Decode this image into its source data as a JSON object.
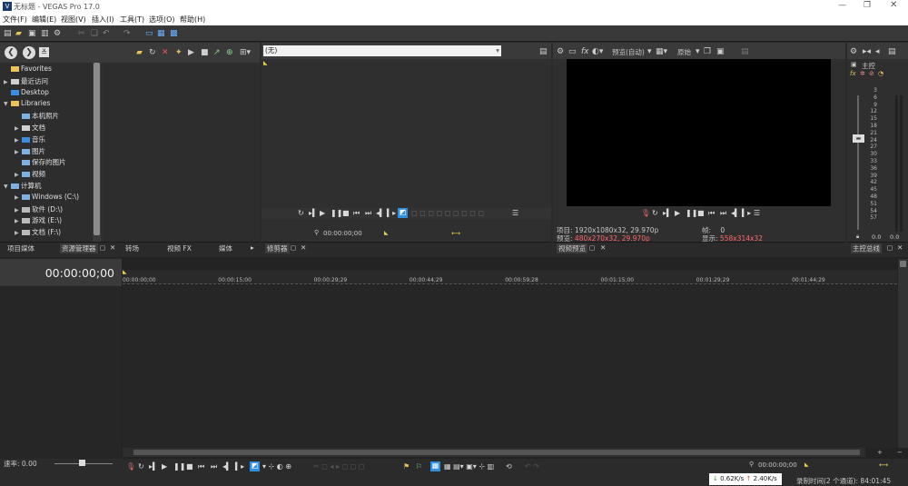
{
  "window": {
    "title": "无标题 - VEGAS Pro 17.0",
    "app_icon": "vegas-icon"
  },
  "menu": [
    "文件(F)",
    "编辑(E)",
    "视图(V)",
    "插入(I)",
    "工具(T)",
    "选项(O)",
    "帮助(H)"
  ],
  "explorer": {
    "items": [
      {
        "label": "Favorites",
        "indent": 0,
        "arrow": "",
        "icon_color": "#e8c35a"
      },
      {
        "label": "最近访问",
        "indent": 0,
        "arrow": "▶",
        "icon_color": "#d0d0d0"
      },
      {
        "label": "Desktop",
        "indent": 0,
        "arrow": "",
        "icon_color": "#3a8de0"
      },
      {
        "label": "Libraries",
        "indent": 0,
        "arrow": "▼",
        "icon_color": "#e8c35a"
      },
      {
        "label": "本机照片",
        "indent": 1,
        "arrow": "",
        "icon_color": "#7fb0e0"
      },
      {
        "label": "文档",
        "indent": 1,
        "arrow": "▶",
        "icon_color": "#d0d0d0"
      },
      {
        "label": "音乐",
        "indent": 1,
        "arrow": "▶",
        "icon_color": "#3a8de0"
      },
      {
        "label": "图片",
        "indent": 1,
        "arrow": "▶",
        "icon_color": "#7fb0e0"
      },
      {
        "label": "保存的图片",
        "indent": 1,
        "arrow": "",
        "icon_color": "#7fb0e0"
      },
      {
        "label": "视频",
        "indent": 1,
        "arrow": "▶",
        "icon_color": "#7fb0e0"
      },
      {
        "label": "计算机",
        "indent": 0,
        "arrow": "▼",
        "icon_color": "#7fb0e0"
      },
      {
        "label": "Windows (C:\\)",
        "indent": 1,
        "arrow": "▶",
        "icon_color": "#7fb0e0"
      },
      {
        "label": "软件 (D:\\)",
        "indent": 1,
        "arrow": "▶",
        "icon_color": "#bbbbbb"
      },
      {
        "label": "游戏 (E:\\)",
        "indent": 1,
        "arrow": "▶",
        "icon_color": "#bbbbbb"
      },
      {
        "label": "文档 (F:\\)",
        "indent": 1,
        "arrow": "▶",
        "icon_color": "#bbbbbb"
      }
    ],
    "tabs": [
      "项目媒体",
      "资源管理器",
      "转场",
      "视频 FX",
      "媒体"
    ]
  },
  "trimmer": {
    "select_value": "(无)",
    "timecode": "00:00:00;00",
    "tab": "修剪器"
  },
  "preview": {
    "quality": "预览(自动)",
    "mode": "原始",
    "project_label": "项目:",
    "project_value": "1920x1080x32, 29.970p",
    "preview_label": "预览:",
    "preview_value": "480x270x32, 29.970p",
    "frame_label": "帧:",
    "frame_value": "0",
    "display_label": "显示:",
    "display_value": "558x314x32",
    "tab": "视频预览"
  },
  "master": {
    "title": "主控",
    "scale": [
      "3",
      "6",
      "9",
      "12",
      "15",
      "18",
      "21",
      "24",
      "27",
      "30",
      "33",
      "36",
      "39",
      "42",
      "45",
      "48",
      "51",
      "54",
      "57"
    ],
    "left_value": "0.0",
    "right_value": "0.0",
    "tab": "主控总线"
  },
  "timeline": {
    "timecode": "00:00:00;00",
    "marks": [
      "00:00:00;00",
      "00:00:15;00",
      "00:00:29;29",
      "00:00:44;29",
      "00:00:59;28",
      "00:01:15;00",
      "00:01:29;29",
      "00:01:44;29"
    ],
    "rate_label": "速率: 0.00",
    "cursor_time": "00:00:00;00"
  },
  "status": {
    "down": "0.62K/s",
    "up": "2.40K/s",
    "record": "录制时间(2 个通道): 84:01:45"
  },
  "colors": {
    "accent": "#2f8fe0",
    "selected_info": "#ff6a6a"
  }
}
